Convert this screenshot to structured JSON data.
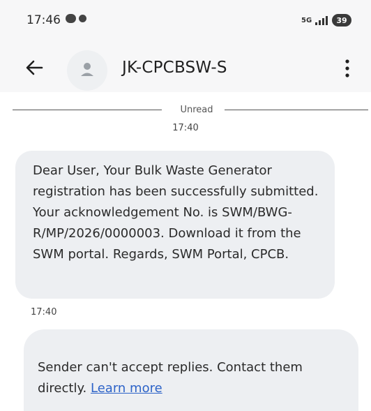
{
  "status_bar": {
    "time": "17:46",
    "network_label": "5G",
    "battery_level": "39"
  },
  "app_bar": {
    "contact_name": "JK-CPCBSW-S"
  },
  "conversation": {
    "unread_label": "Unread",
    "divider_time": "17:40",
    "message": {
      "text": "Dear User, Your Bulk Waste Generator registration has been successfully submitted. Your acknowledgement No. is SWM/BWG-R/MP/2026/0000003. Download it from the SWM portal. Regards, SWM Portal, CPCB.",
      "time": "17:40"
    },
    "reply_notice": {
      "text": "Sender can't accept replies. Contact them directly.",
      "link": "Learn more"
    }
  },
  "icons": {
    "back": "back-arrow-icon",
    "avatar": "person-icon",
    "menu": "more-vert-icon"
  }
}
